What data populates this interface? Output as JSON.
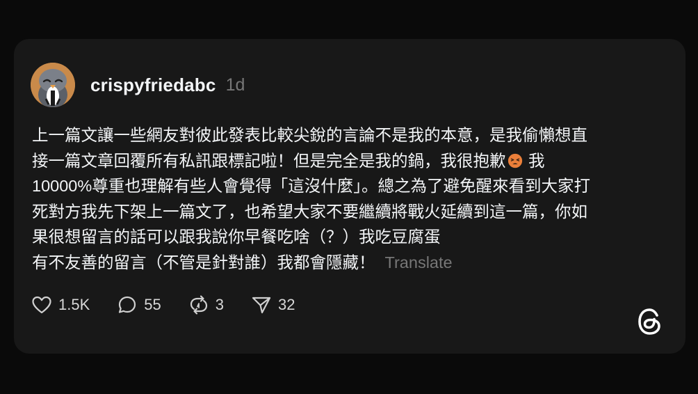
{
  "post": {
    "username": "crispyfriedabc",
    "timestamp": "1d",
    "lines": [
      "上一篇文讓一些網友對彼此發表比較尖銳的言論不是我的本意，是我偷懶想直",
      "接一篇文章回覆所有私訊跟標記啦！但是完全是我的鍋，我很抱歉",
      "我",
      "10000%尊重也理解有些人會覺得「這沒什麼」。總之為了避免醒來看到大家打",
      "死對方我先下架上一篇文了，也希望大家不要繼續將戰火延續到這一篇，你如",
      "果很想留言的話可以跟我說你早餐吃啥（？）我吃豆腐蛋",
      "有不友善的留言（不管是針對誰）我都會隱藏！"
    ],
    "translate_label": "Translate",
    "emoji_icon": "tired-face-emoji-icon"
  },
  "actions": {
    "likes": "1.5K",
    "comments": "55",
    "reposts": "3",
    "shares": "32"
  },
  "brand": {
    "logo_icon": "threads-logo-icon"
  },
  "colors": {
    "background": "#0a0a0a",
    "card": "#181818",
    "text": "#f3f5f7",
    "muted": "#777777"
  }
}
